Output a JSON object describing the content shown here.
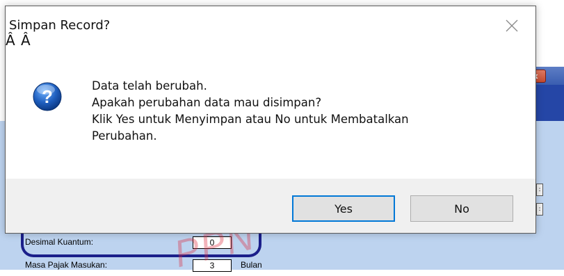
{
  "background_app": {
    "close_glyph": "x",
    "fields": [
      {
        "label": "Desimal Kuantum:",
        "value": "0"
      },
      {
        "label": "Masa Pajak Masukan:",
        "value": "3",
        "unit": "Bulan"
      }
    ],
    "side_buttons": [
      ":",
      ":"
    ],
    "watermark_text": "PPN"
  },
  "dialog": {
    "title": "Simpan Record?",
    "title_artifact": "Â Â",
    "icon": "question-icon",
    "message_lines": [
      "Data telah berubah.",
      "Apakah perubahan data mau disimpan?",
      "Klik Yes untuk Menyimpan atau No untuk Membatalkan",
      "Perubahan."
    ],
    "buttons": {
      "yes": "Yes",
      "no": "No"
    }
  },
  "colors": {
    "dialog_accent": "#0078d7",
    "panel_bg": "#bdd3ef",
    "window_band": "#2546a6",
    "icon_blue": "#1f5fbf"
  }
}
